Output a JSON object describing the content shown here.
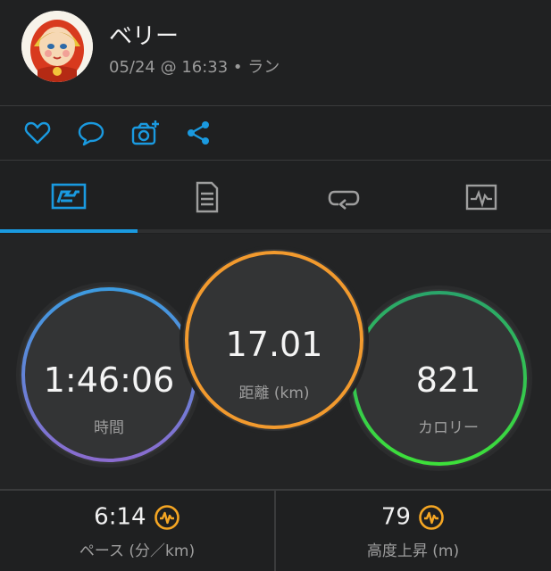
{
  "header": {
    "user_name": "ベリー",
    "meta": "05/24 @ 16:33 • ラン"
  },
  "actions": [
    {
      "icon": "heart-icon"
    },
    {
      "icon": "comment-icon"
    },
    {
      "icon": "add-photo-icon"
    },
    {
      "icon": "share-icon"
    }
  ],
  "tabs": [
    {
      "icon": "stats-icon",
      "active": true
    },
    {
      "icon": "details-icon",
      "active": false
    },
    {
      "icon": "laps-icon",
      "active": false
    },
    {
      "icon": "chart-icon",
      "active": false
    }
  ],
  "stats": {
    "time": {
      "value": "1:46:06",
      "label": "時間"
    },
    "distance": {
      "value": "17.01",
      "label": "距離 (km)"
    },
    "calories": {
      "value": "821",
      "label": "カロリー"
    }
  },
  "bottom": {
    "pace": {
      "value": "6:14",
      "label": "ペース (分／km)"
    },
    "elevation": {
      "value": "79",
      "label": "高度上昇 (m)"
    }
  },
  "colors": {
    "accent": "#1a9ae0",
    "time_ring_top": "#3d9be0",
    "time_ring_bottom": "#8a6ccf",
    "distance_ring": "#f29a2e",
    "calories_ring": "#2ecc40",
    "badge": "#f5a623"
  }
}
